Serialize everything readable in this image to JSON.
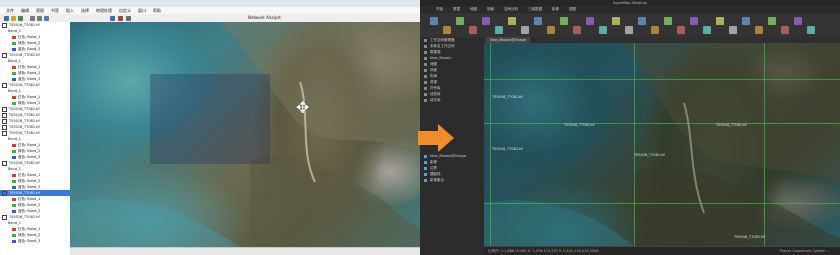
{
  "left_app": {
    "toc_items": [
      {
        "label": "T05016_T7081.tif",
        "kind": "layer"
      },
      {
        "label": "Band_1",
        "kind": "band"
      },
      {
        "label": "红色: Band_1",
        "kind": "red"
      },
      {
        "label": "绿色: Band_2",
        "kind": "green"
      },
      {
        "label": "蓝色: Band_3",
        "kind": "blue"
      },
      {
        "label": "T05016_T7081.tif",
        "kind": "layer"
      },
      {
        "label": "Band_1",
        "kind": "band"
      },
      {
        "label": "红色: Band_1",
        "kind": "red"
      },
      {
        "label": "绿色: Band_2",
        "kind": "green"
      },
      {
        "label": "蓝色: Band_3",
        "kind": "blue"
      },
      {
        "label": "T05016_T7081.tif",
        "kind": "layer"
      },
      {
        "label": "Band_1",
        "kind": "band"
      },
      {
        "label": "红色: Band_1",
        "kind": "red"
      },
      {
        "label": "绿色: Band_2",
        "kind": "green"
      },
      {
        "label": "T05016_T7081.tif",
        "kind": "layer"
      },
      {
        "label": "T05016_T7081.tif",
        "kind": "layer"
      },
      {
        "label": "T05016_T7081.tif",
        "kind": "layer"
      },
      {
        "label": "T05016_T7081.tif",
        "kind": "layer"
      },
      {
        "label": "T05016_T7081.tif",
        "kind": "layer"
      },
      {
        "label": "Band_1",
        "kind": "band"
      },
      {
        "label": "红色: Band_1",
        "kind": "red"
      },
      {
        "label": "绿色: Band_2",
        "kind": "green"
      },
      {
        "label": "蓝色: Band_3",
        "kind": "blue"
      },
      {
        "label": "T05016_T7081.tif",
        "kind": "layer"
      },
      {
        "label": "Band_1",
        "kind": "band"
      },
      {
        "label": "红色: Band_1",
        "kind": "red"
      },
      {
        "label": "绿色: Band_2",
        "kind": "green"
      },
      {
        "label": "蓝色: Band_3",
        "kind": "blue"
      },
      {
        "label": "T05016_T7081.tif",
        "kind": "layer-selected"
      },
      {
        "label": "红色: Band_1",
        "kind": "red"
      },
      {
        "label": "绿色: Band_2",
        "kind": "green"
      },
      {
        "label": "蓝色: Band_3",
        "kind": "blue"
      },
      {
        "label": "T05016_T7081.tif",
        "kind": "layer"
      },
      {
        "label": "Band_1",
        "kind": "band"
      },
      {
        "label": "红色: Band_1",
        "kind": "red"
      },
      {
        "label": "绿色: Band_2",
        "kind": "green"
      },
      {
        "label": "蓝色: Band_3",
        "kind": "blue"
      }
    ],
    "toolbar_label": "Network Analyst"
  },
  "right_app": {
    "title": "SuperMap iDesktop",
    "ribbon_tabs": [
      "开始",
      "数据",
      "地图",
      "场景",
      "空间分析",
      "三维数据",
      "影像",
      "视图"
    ],
    "workspace_items": [
      {
        "label": "工作空间管理器"
      },
      {
        "label": "未命名工作空间"
      },
      {
        "label": "数据源"
      },
      {
        "label": "New_Mosaic"
      },
      {
        "label": "地图"
      },
      {
        "label": "场景"
      },
      {
        "label": "布局"
      },
      {
        "label": "资源"
      },
      {
        "label": "符号库"
      },
      {
        "label": "线型库"
      },
      {
        "label": "填充库"
      }
    ],
    "layer_items": [
      {
        "label": "New_Mosaic@Image"
      },
      {
        "label": "影像"
      },
      {
        "label": "边界"
      },
      {
        "label": "镶嵌线"
      },
      {
        "label": "影像集合"
      }
    ],
    "map_tab": "New_Mosaic@Image",
    "tile_labels": [
      "T05016_T7081.tif",
      "T05016_T7081.tif",
      "T05016_T7081.tif",
      "T05016_T7081.tif",
      "T05016_T7081.tif",
      "T05016_T7081.tif"
    ],
    "status_left": "比例尺: 1:1,888.02400  X: 3,478,124,270  Y: 2,541,118,010.0208",
    "status_right": "Planar Coordinate System ..."
  },
  "colors": {
    "arrow": "#f08c2a",
    "grid": "#3cb94a",
    "selected": "#3b78d8"
  }
}
